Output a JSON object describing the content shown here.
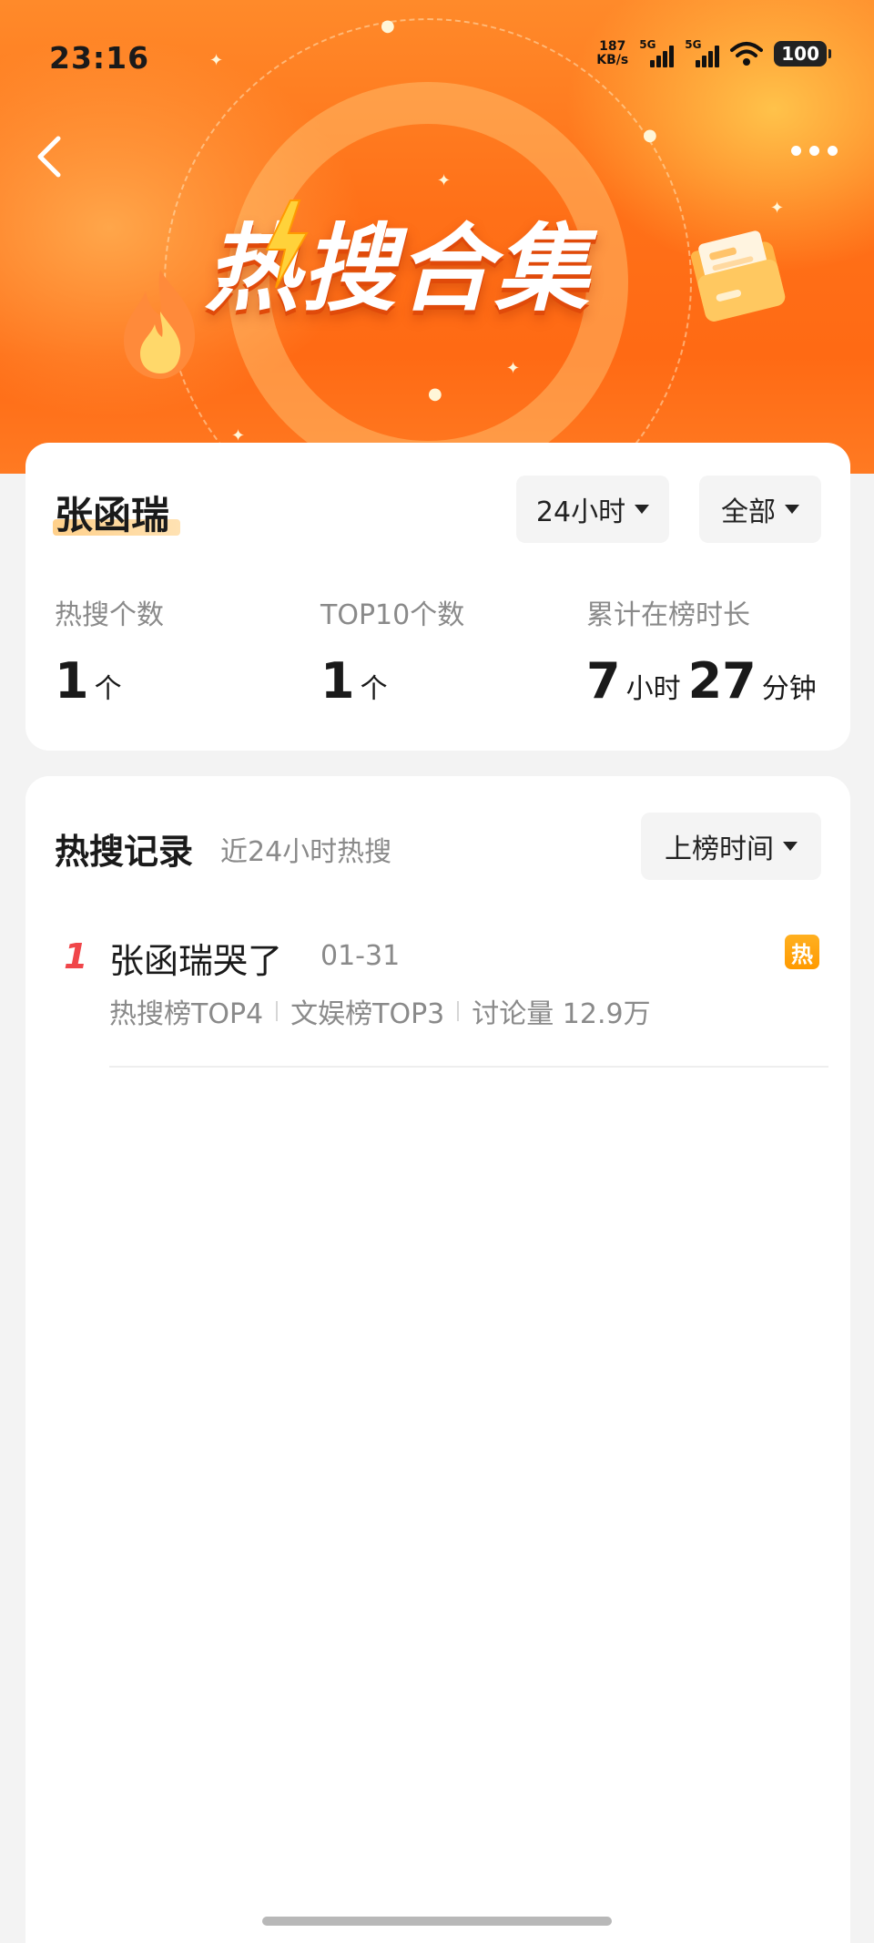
{
  "status_bar": {
    "time": "23:16",
    "net_speed_value": "187",
    "net_speed_unit": "KB/s",
    "signal1_label": "5G",
    "signal2_label": "5G",
    "battery": "100"
  },
  "header": {
    "banner_title": "热搜合集",
    "accent_color": "#ff7018"
  },
  "summary": {
    "name": "张函瑞",
    "time_filter": "24小时",
    "category_filter": "全部",
    "stats": [
      {
        "label": "热搜个数",
        "value": "1",
        "unit": "个"
      },
      {
        "label": "TOP10个数",
        "value": "1",
        "unit": "个"
      },
      {
        "label": "累计在榜时长",
        "hours": "7",
        "hours_unit": "小时",
        "minutes": "27",
        "minutes_unit": "分钟"
      }
    ]
  },
  "records": {
    "title": "热搜记录",
    "subtitle": "近24小时热搜",
    "sort_label": "上榜时间",
    "items": [
      {
        "rank": "1",
        "title": "张函瑞哭了",
        "date": "01-31",
        "badge": "热",
        "meta": [
          "热搜榜TOP4",
          "文娱榜TOP3",
          "讨论量 12.9万"
        ]
      }
    ]
  }
}
